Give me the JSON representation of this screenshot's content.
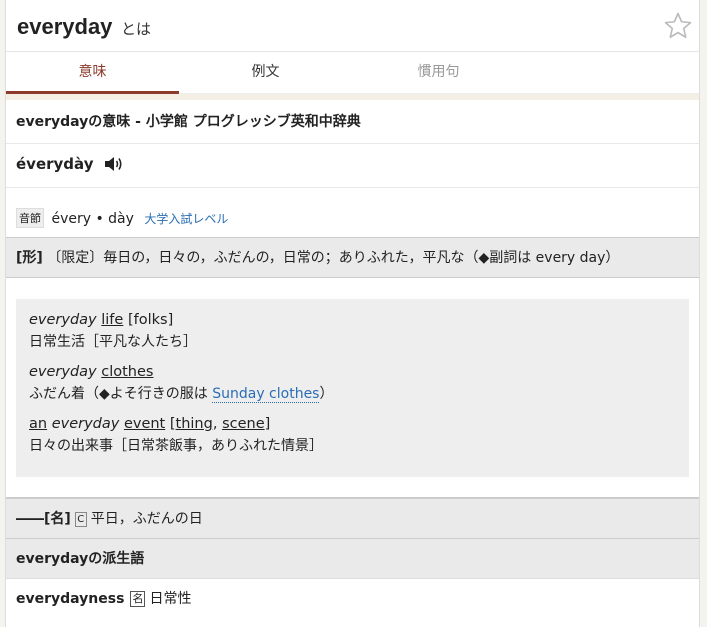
{
  "header": {
    "headword": "everyday",
    "suffix": "とは"
  },
  "tabs": [
    {
      "label": "意味"
    },
    {
      "label": "例文"
    },
    {
      "label": "慣用句"
    }
  ],
  "dictionary": {
    "title": "everydayの意味 - 小学館 プログレッシブ英和中辞典",
    "pronunciation": "évery­dày",
    "syllable_badge": "音節",
    "syllables": "évery • dày",
    "level": "大学入試レベル",
    "definition": {
      "pos": "[形]",
      "text": "〔限定〕毎日の，日々の，ふだんの，日常の；ありふれた，平凡な（◆副詞は every day）"
    },
    "examples": [
      {
        "en_italic": "everyday",
        "en_under": "life",
        "en_rest": " [folks]",
        "ja": "日常生活［平凡な人たち］"
      },
      {
        "en_italic": "everyday",
        "en_under": "clothes",
        "ja_before": "ふだん着（◆よそ行きの服は ",
        "ja_link": "Sunday clothes",
        "ja_after": "）"
      },
      {
        "an": "an",
        "en_italic": "everyday",
        "en_under": "event",
        "alt1": "thing",
        "alt2": "scene",
        "ja": "日々の出来事［日常茶飯事，ありふれた情景］"
      }
    ],
    "noun": {
      "prefix": "――[名]",
      "badge": "C",
      "text": "平日，ふだんの日"
    },
    "derivative_header": "everydayの派生語",
    "derivative": {
      "word": "everydayness",
      "badge": "名",
      "meaning": "日常性"
    }
  },
  "colors": {
    "accent": "#8b3a2b",
    "link": "#2a6db5"
  },
  "icons": {
    "favorite": "star-outline-icon",
    "audio": "speaker-icon"
  }
}
